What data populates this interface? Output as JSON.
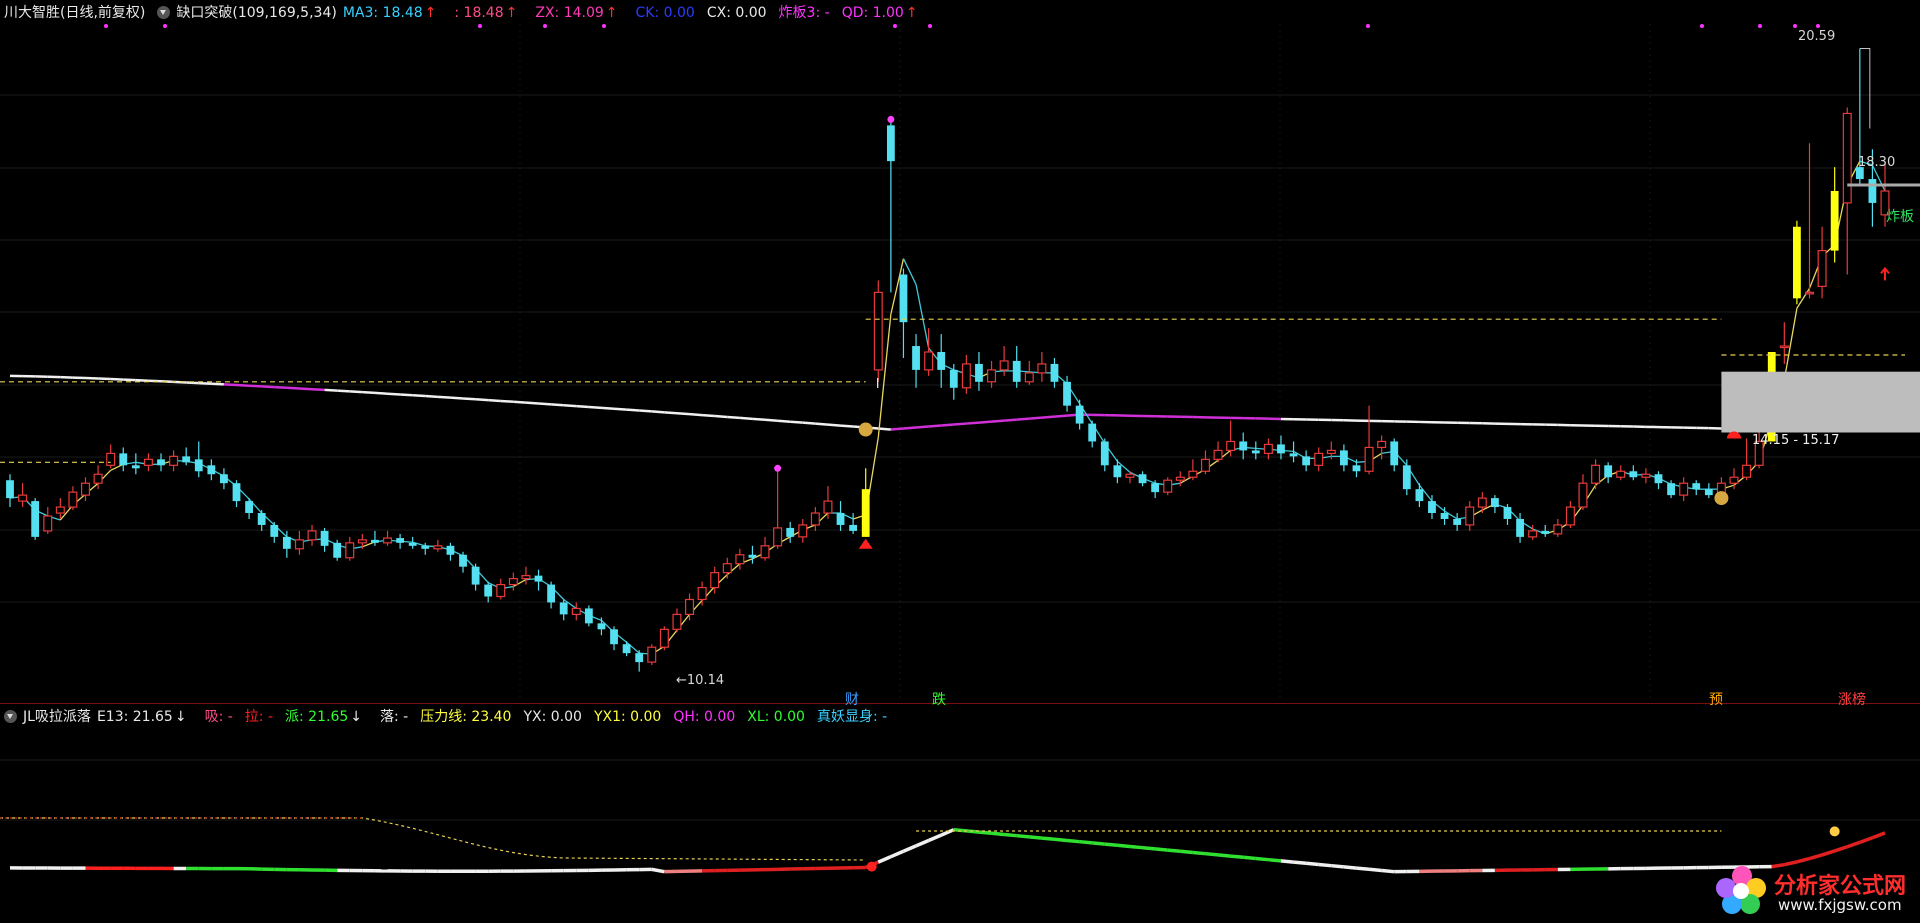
{
  "top_indicator": {
    "stock_title": "川大智胜(日线,前复权)",
    "indicator_name": "缺口突破(109,169,5,34)",
    "items": [
      {
        "label": "MA3: 18.48",
        "arrow": "↑",
        "color": "#39d0ff"
      },
      {
        "label": ": 18.48",
        "arrow": "↑",
        "color": "#ff4b8a"
      },
      {
        "label": "ZX: 14.09",
        "arrow": "↑",
        "color": "#ff3bb8"
      },
      {
        "label": "CK: 0.00",
        "arrow": "",
        "color": "#2b3bff"
      },
      {
        "label": "CX: 0.00",
        "arrow": "",
        "color": "#e8e8e8"
      },
      {
        "label": "炸板3: -",
        "arrow": "",
        "color": "#ff33ff"
      },
      {
        "label": "QD: 1.00",
        "arrow": "↑",
        "color": "#ff33ff"
      }
    ]
  },
  "bottom_indicator": {
    "indicator_name": "JL吸拉派落",
    "items": [
      {
        "label": "E13: 21.65",
        "arrow": "↓",
        "color": "#e8e8e8"
      },
      {
        "label": "吸: -",
        "arrow": "",
        "color": "#ff4b8a"
      },
      {
        "label": "拉: -",
        "arrow": "",
        "color": "#ff2020"
      },
      {
        "label": "派: 21.65",
        "arrow": "↓",
        "color": "#30ff30"
      },
      {
        "label": "落: -",
        "arrow": "",
        "color": "#e8e8e8"
      },
      {
        "label": "压力线: 23.40",
        "arrow": "",
        "color": "#ffff40"
      },
      {
        "label": "YX: 0.00",
        "arrow": "",
        "color": "#e8e8e8"
      },
      {
        "label": "YX1: 0.00",
        "arrow": "",
        "color": "#ffff40"
      },
      {
        "label": "QH: 0.00",
        "arrow": "",
        "color": "#ff33ff"
      },
      {
        "label": "XL: 0.00",
        "arrow": "",
        "color": "#30ff30"
      },
      {
        "label": "真妖显身: -",
        "arrow": "",
        "color": "#39d0ff"
      }
    ]
  },
  "chart_labels": {
    "high_price": "20.59",
    "low_price": "←10.14",
    "price_level": "18.30",
    "gap_zone": "14.15 - 15.17",
    "zhaban": "炸板",
    "marker_cai": "财",
    "marker_die": "跌",
    "marker_yu": "预",
    "marker_zhangbang": "涨榜"
  },
  "watermark": {
    "title": "分析家公式网",
    "url": "www.fxjgsw.com"
  },
  "chart_data": {
    "type": "candlestick",
    "price_axis_range": [
      10.0,
      21.0
    ],
    "candles": [
      [
        13.35,
        13.05,
        13.45,
        12.9
      ],
      [
        13.0,
        13.1,
        13.3,
        12.9
      ],
      [
        13.0,
        12.4,
        13.05,
        12.35
      ],
      [
        12.5,
        12.75,
        12.9,
        12.45
      ],
      [
        12.8,
        12.9,
        13.05,
        12.7
      ],
      [
        12.9,
        13.15,
        13.25,
        12.85
      ],
      [
        13.1,
        13.3,
        13.4,
        13.0
      ],
      [
        13.3,
        13.45,
        13.6,
        13.2
      ],
      [
        13.6,
        13.8,
        13.95,
        13.55
      ],
      [
        13.8,
        13.6,
        13.9,
        13.5
      ],
      [
        13.6,
        13.55,
        13.8,
        13.45
      ],
      [
        13.6,
        13.7,
        13.8,
        13.5
      ],
      [
        13.7,
        13.6,
        13.8,
        13.5
      ],
      [
        13.6,
        13.75,
        13.85,
        13.5
      ],
      [
        13.75,
        13.65,
        13.9,
        13.6
      ],
      [
        13.7,
        13.5,
        14.0,
        13.4
      ],
      [
        13.6,
        13.45,
        13.7,
        13.35
      ],
      [
        13.45,
        13.3,
        13.55,
        13.2
      ],
      [
        13.3,
        13.0,
        13.35,
        12.9
      ],
      [
        13.0,
        12.8,
        13.05,
        12.7
      ],
      [
        12.8,
        12.6,
        12.85,
        12.5
      ],
      [
        12.6,
        12.4,
        12.65,
        12.3
      ],
      [
        12.4,
        12.2,
        12.5,
        12.05
      ],
      [
        12.2,
        12.35,
        12.5,
        12.1
      ],
      [
        12.35,
        12.5,
        12.6,
        12.25
      ],
      [
        12.5,
        12.25,
        12.55,
        12.15
      ],
      [
        12.3,
        12.05,
        12.35,
        12.0
      ],
      [
        12.05,
        12.3,
        12.4,
        12.0
      ],
      [
        12.3,
        12.35,
        12.45,
        12.2
      ],
      [
        12.35,
        12.3,
        12.5,
        12.25
      ],
      [
        12.3,
        12.38,
        12.5,
        12.25
      ],
      [
        12.38,
        12.3,
        12.45,
        12.2
      ],
      [
        12.3,
        12.25,
        12.4,
        12.2
      ],
      [
        12.25,
        12.2,
        12.3,
        12.1
      ],
      [
        12.2,
        12.25,
        12.35,
        12.15
      ],
      [
        12.25,
        12.1,
        12.3,
        12.0
      ],
      [
        12.1,
        11.9,
        12.15,
        11.8
      ],
      [
        11.9,
        11.6,
        11.95,
        11.5
      ],
      [
        11.6,
        11.4,
        11.65,
        11.3
      ],
      [
        11.4,
        11.6,
        11.7,
        11.35
      ],
      [
        11.6,
        11.7,
        11.8,
        11.5
      ],
      [
        11.7,
        11.75,
        11.9,
        11.6
      ],
      [
        11.75,
        11.65,
        11.85,
        11.5
      ],
      [
        11.6,
        11.3,
        11.65,
        11.2
      ],
      [
        11.3,
        11.1,
        11.35,
        11.0
      ],
      [
        11.1,
        11.2,
        11.3,
        11.0
      ],
      [
        11.2,
        10.95,
        11.25,
        10.9
      ],
      [
        10.95,
        10.85,
        11.05,
        10.75
      ],
      [
        10.85,
        10.6,
        10.9,
        10.5
      ],
      [
        10.6,
        10.45,
        10.65,
        10.4
      ],
      [
        10.45,
        10.3,
        10.5,
        10.14
      ],
      [
        10.3,
        10.55,
        10.6,
        10.25
      ],
      [
        10.55,
        10.85,
        10.9,
        10.5
      ],
      [
        10.85,
        11.1,
        11.2,
        10.8
      ],
      [
        11.1,
        11.35,
        11.45,
        11.0
      ],
      [
        11.35,
        11.55,
        11.65,
        11.25
      ],
      [
        11.55,
        11.8,
        11.9,
        11.45
      ],
      [
        11.8,
        11.95,
        12.05,
        11.7
      ],
      [
        11.95,
        12.1,
        12.2,
        11.85
      ],
      [
        12.1,
        12.05,
        12.25,
        11.95
      ],
      [
        12.05,
        12.25,
        12.4,
        12.0
      ],
      [
        12.25,
        12.55,
        13.55,
        12.2
      ],
      [
        12.55,
        12.4,
        12.65,
        12.3
      ],
      [
        12.4,
        12.6,
        12.7,
        12.3
      ],
      [
        12.6,
        12.8,
        12.9,
        12.5
      ],
      [
        12.8,
        13.0,
        13.25,
        12.7
      ],
      [
        12.8,
        12.6,
        13.0,
        12.5
      ],
      [
        12.6,
        12.5,
        12.8,
        12.45
      ],
      [
        12.4,
        13.2,
        13.55,
        12.4
      ],
      [
        15.2,
        16.5,
        16.7,
        15.0
      ],
      [
        19.3,
        18.7,
        19.4,
        16.5
      ],
      [
        16.8,
        16.0,
        16.9,
        15.4
      ],
      [
        15.6,
        15.2,
        15.8,
        14.9
      ],
      [
        15.2,
        15.5,
        15.9,
        15.1
      ],
      [
        15.5,
        15.2,
        15.8,
        14.9
      ],
      [
        15.2,
        14.9,
        15.3,
        14.7
      ],
      [
        14.9,
        15.3,
        15.45,
        14.8
      ],
      [
        15.3,
        15.0,
        15.5,
        14.85
      ],
      [
        15.0,
        15.2,
        15.35,
        14.9
      ],
      [
        15.2,
        15.35,
        15.6,
        15.1
      ],
      [
        15.35,
        15.0,
        15.6,
        14.9
      ],
      [
        15.0,
        15.15,
        15.35,
        14.95
      ],
      [
        15.15,
        15.3,
        15.5,
        15.0
      ],
      [
        15.3,
        15.0,
        15.4,
        14.9
      ],
      [
        15.0,
        14.6,
        15.1,
        14.5
      ],
      [
        14.6,
        14.3,
        14.7,
        14.2
      ],
      [
        14.3,
        14.0,
        14.35,
        13.9
      ],
      [
        14.0,
        13.6,
        14.05,
        13.5
      ],
      [
        13.6,
        13.4,
        13.7,
        13.3
      ],
      [
        13.4,
        13.45,
        13.5,
        13.3
      ],
      [
        13.45,
        13.3,
        13.5,
        13.25
      ],
      [
        13.3,
        13.15,
        13.35,
        13.05
      ],
      [
        13.15,
        13.35,
        13.4,
        13.1
      ],
      [
        13.35,
        13.4,
        13.5,
        13.25
      ],
      [
        13.4,
        13.5,
        13.7,
        13.35
      ],
      [
        13.5,
        13.7,
        13.85,
        13.45
      ],
      [
        13.7,
        13.85,
        14.0,
        13.65
      ],
      [
        13.85,
        14.0,
        14.35,
        13.75
      ],
      [
        14.0,
        13.85,
        14.15,
        13.7
      ],
      [
        13.85,
        13.8,
        14.0,
        13.7
      ],
      [
        13.8,
        13.95,
        14.05,
        13.7
      ],
      [
        13.95,
        13.8,
        14.1,
        13.7
      ],
      [
        13.8,
        13.75,
        14.0,
        13.65
      ],
      [
        13.75,
        13.6,
        13.85,
        13.5
      ],
      [
        13.6,
        13.8,
        13.9,
        13.5
      ],
      [
        13.8,
        13.85,
        14.0,
        13.7
      ],
      [
        13.85,
        13.6,
        13.95,
        13.5
      ],
      [
        13.6,
        13.5,
        13.7,
        13.4
      ],
      [
        13.5,
        13.9,
        14.6,
        13.45
      ],
      [
        13.9,
        14.0,
        14.1,
        13.7
      ],
      [
        14.0,
        13.6,
        14.05,
        13.5
      ],
      [
        13.6,
        13.2,
        13.7,
        13.1
      ],
      [
        13.2,
        13.0,
        13.3,
        12.9
      ],
      [
        13.0,
        12.8,
        13.1,
        12.7
      ],
      [
        12.8,
        12.7,
        12.9,
        12.6
      ],
      [
        12.7,
        12.6,
        12.8,
        12.5
      ],
      [
        12.6,
        12.9,
        13.0,
        12.5
      ],
      [
        12.9,
        13.05,
        13.15,
        12.8
      ],
      [
        13.05,
        12.9,
        13.1,
        12.8
      ],
      [
        12.9,
        12.7,
        12.95,
        12.6
      ],
      [
        12.7,
        12.4,
        12.8,
        12.3
      ],
      [
        12.4,
        12.5,
        12.6,
        12.35
      ],
      [
        12.5,
        12.45,
        12.6,
        12.4
      ],
      [
        12.45,
        12.6,
        12.7,
        12.4
      ],
      [
        12.6,
        12.9,
        13.0,
        12.55
      ],
      [
        12.9,
        13.3,
        13.45,
        12.85
      ],
      [
        13.3,
        13.6,
        13.7,
        13.2
      ],
      [
        13.6,
        13.4,
        13.65,
        13.3
      ],
      [
        13.4,
        13.5,
        13.6,
        13.35
      ],
      [
        13.5,
        13.4,
        13.6,
        13.35
      ],
      [
        13.4,
        13.45,
        13.55,
        13.3
      ],
      [
        13.45,
        13.3,
        13.5,
        13.2
      ],
      [
        13.3,
        13.1,
        13.35,
        13.05
      ],
      [
        13.1,
        13.3,
        13.4,
        13.0
      ],
      [
        13.3,
        13.2,
        13.35,
        13.1
      ],
      [
        13.2,
        13.1,
        13.3,
        13.05
      ],
      [
        13.1,
        13.3,
        13.4,
        13.05
      ],
      [
        13.3,
        13.4,
        13.55,
        13.2
      ],
      [
        13.4,
        13.6,
        14.05,
        13.35
      ],
      [
        13.6,
        14.0,
        14.45,
        13.55
      ],
      [
        14.0,
        15.5,
        15.5,
        14.0
      ],
      [
        15.6,
        15.6,
        16.0,
        15.3
      ],
      [
        16.4,
        17.6,
        17.7,
        16.3
      ],
      [
        16.5,
        16.5,
        19.0,
        16.4
      ],
      [
        16.6,
        17.2,
        17.6,
        16.4
      ],
      [
        17.2,
        18.2,
        18.6,
        17.0
      ],
      [
        18.0,
        19.5,
        19.6,
        16.8
      ],
      [
        18.6,
        18.4,
        20.59,
        18.3
      ],
      [
        18.4,
        18.0,
        18.9,
        17.6
      ],
      [
        17.8,
        18.2,
        18.7,
        17.6
      ]
    ],
    "price_lines": [
      {
        "name": "ZX",
        "color": "#ff33ff"
      },
      {
        "name": "MA3",
        "color": "#39d0ff"
      }
    ],
    "levels": {
      "upper_dash": 16.05,
      "mid_dash": 15.45,
      "left_dash": 13.65,
      "gap_low": 14.15,
      "gap_high": 15.17,
      "level_line": 18.3
    }
  }
}
